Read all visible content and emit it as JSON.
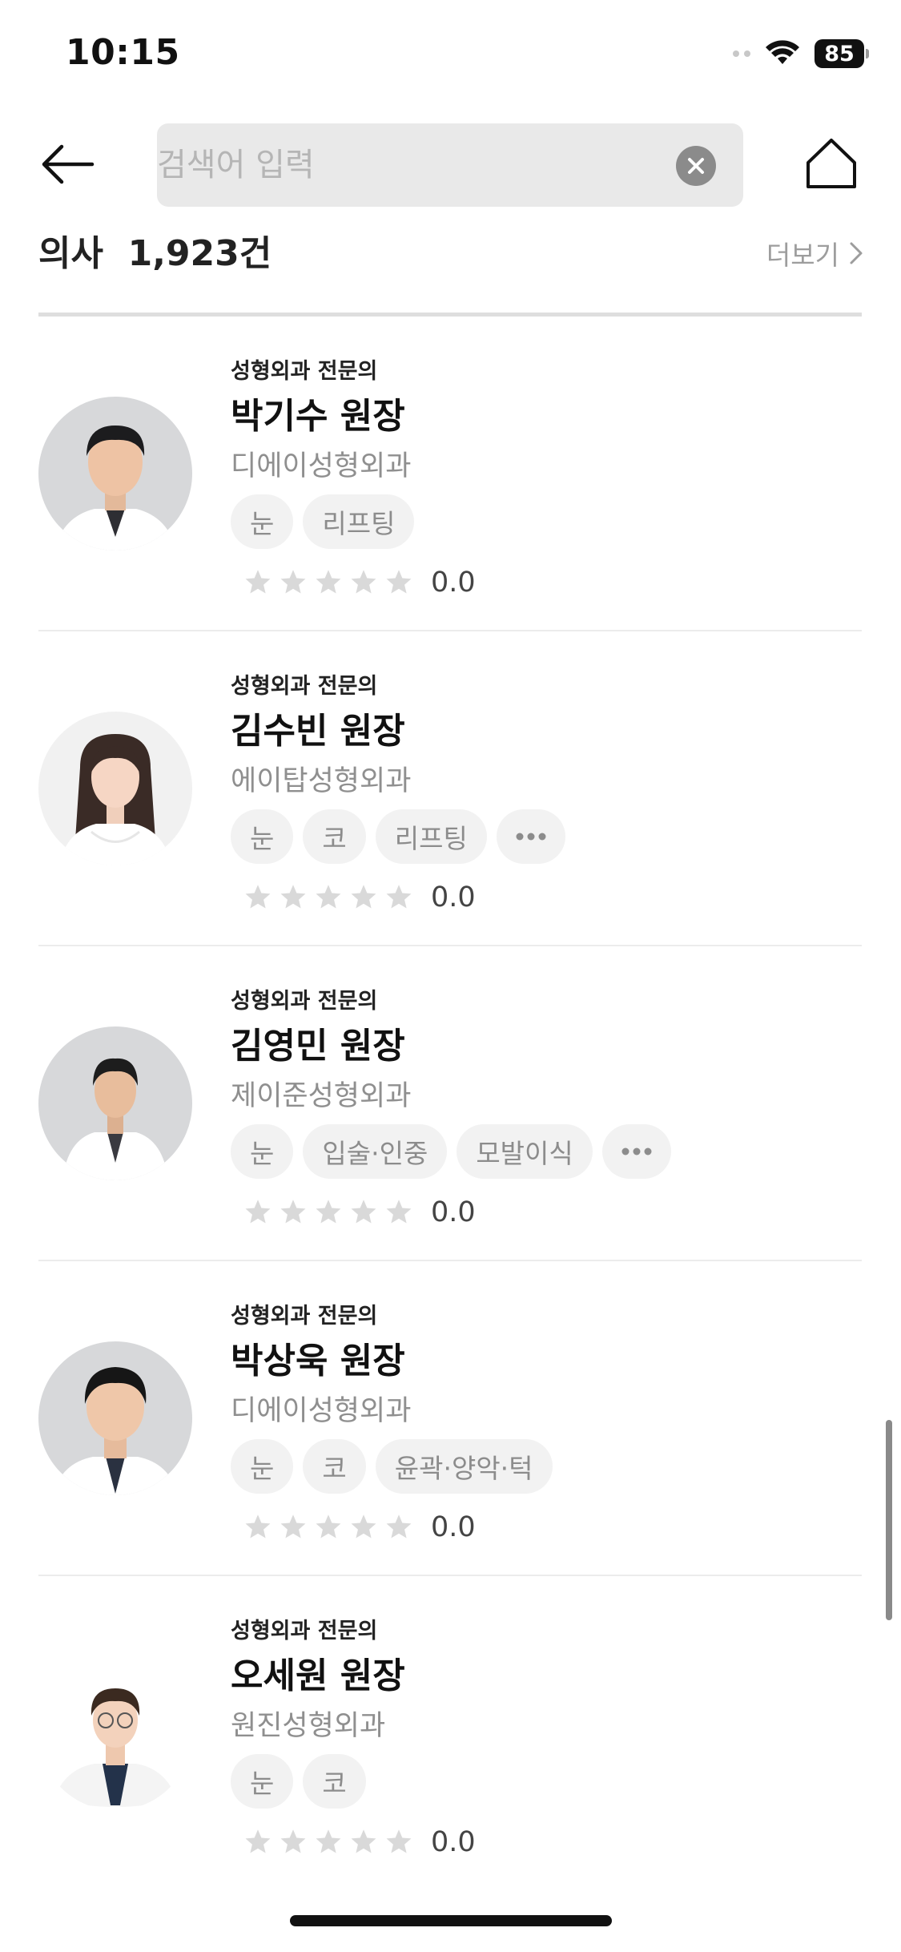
{
  "status_bar": {
    "time": "10:15",
    "battery": "85",
    "icons": [
      "signal-icon",
      "wifi-icon",
      "battery-icon"
    ]
  },
  "header": {
    "back_icon": "arrow-left-icon",
    "search_placeholder": "검색어 입력",
    "search_value": "",
    "clear_icon": "clear-circle-icon",
    "home_icon": "home-icon"
  },
  "section": {
    "title": "의사  1,923건",
    "more_label": "더보기",
    "more_icon": "chevron-right-icon"
  },
  "doctors": [
    {
      "specialty": "성형외과 전문의",
      "name": "박기수 원장",
      "hospital": "디에이성형외과",
      "tags": [
        "눈",
        "리프팅"
      ],
      "has_more": false,
      "rating": "0.0"
    },
    {
      "specialty": "성형외과 전문의",
      "name": "김수빈 원장",
      "hospital": "에이탑성형외과",
      "tags": [
        "눈",
        "코",
        "리프팅"
      ],
      "has_more": true,
      "rating": "0.0"
    },
    {
      "specialty": "성형외과 전문의",
      "name": "김영민 원장",
      "hospital": "제이준성형외과",
      "tags": [
        "눈",
        "입술·인중",
        "모발이식"
      ],
      "has_more": true,
      "rating": "0.0"
    },
    {
      "specialty": "성형외과 전문의",
      "name": "박상욱 원장",
      "hospital": "디에이성형외과",
      "tags": [
        "눈",
        "코",
        "윤곽·양악·턱"
      ],
      "has_more": false,
      "rating": "0.0"
    },
    {
      "specialty": "성형외과 전문의",
      "name": "오세원 원장",
      "hospital": "원진성형외과",
      "tags": [
        "눈",
        "코"
      ],
      "has_more": false,
      "rating": "0.0"
    }
  ],
  "colors": {
    "star_empty": "#d9d9d9",
    "tag_bg": "#f2f2f2",
    "search_bg": "#e9e9e9"
  }
}
